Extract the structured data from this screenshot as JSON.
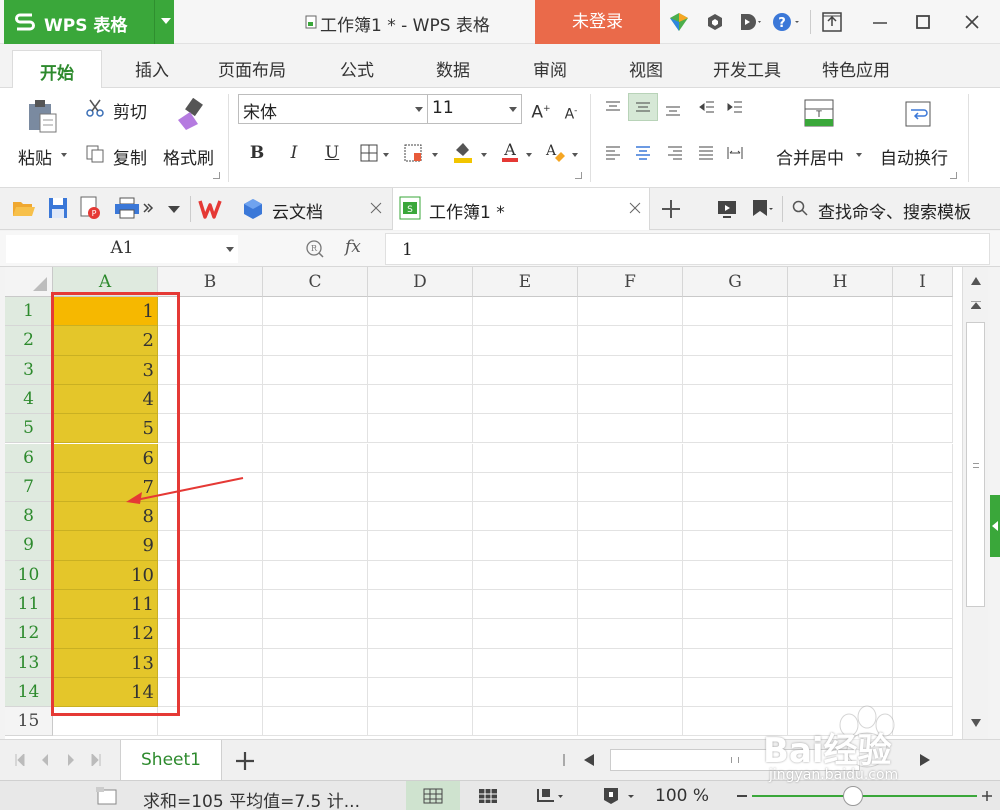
{
  "titlebar": {
    "app_name": "WPS 表格",
    "doc_title": "工作簿1 * - WPS 表格",
    "login": "未登录"
  },
  "ribbon_tabs": [
    "开始",
    "插入",
    "页面布局",
    "公式",
    "数据",
    "审阅",
    "视图",
    "开发工具",
    "特色应用"
  ],
  "ribbon": {
    "paste": "粘贴",
    "cut": "剪切",
    "copy": "复制",
    "format_painter": "格式刷",
    "font_name": "宋体",
    "font_size": "11",
    "bold": "B",
    "italic": "I",
    "underline": "U",
    "merge_center": "合并居中",
    "wrap_text": "自动换行"
  },
  "quickbar": {
    "cloud_docs": "云文档",
    "workbook_tab": "工作簿1 *",
    "search": "查找命令、搜索模板"
  },
  "formula_bar": {
    "name_box": "A1",
    "fx": "fx",
    "content": "1"
  },
  "grid": {
    "columns": [
      "A",
      "B",
      "C",
      "D",
      "E",
      "F",
      "G",
      "H",
      "I"
    ],
    "rows": [
      "1",
      "2",
      "3",
      "4",
      "5",
      "6",
      "7",
      "8",
      "9",
      "10",
      "11",
      "12",
      "13",
      "14",
      "15"
    ],
    "column_a_values": [
      "1",
      "2",
      "3",
      "4",
      "5",
      "6",
      "7",
      "8",
      "9",
      "10",
      "11",
      "12",
      "13",
      "14"
    ]
  },
  "sheet_tabs": [
    "Sheet1"
  ],
  "status": {
    "summary": "求和=105  平均值=7.5  计...",
    "zoom": "100 %"
  },
  "watermark": {
    "logo": "Bai经验",
    "url": "jingyan.baidu.com"
  },
  "colors": {
    "accent": "#3aa73a",
    "login": "#ea6a4a",
    "selection_fill": "#e4c62a",
    "active_cell": "#f6b800",
    "annotation": "#e53935"
  }
}
